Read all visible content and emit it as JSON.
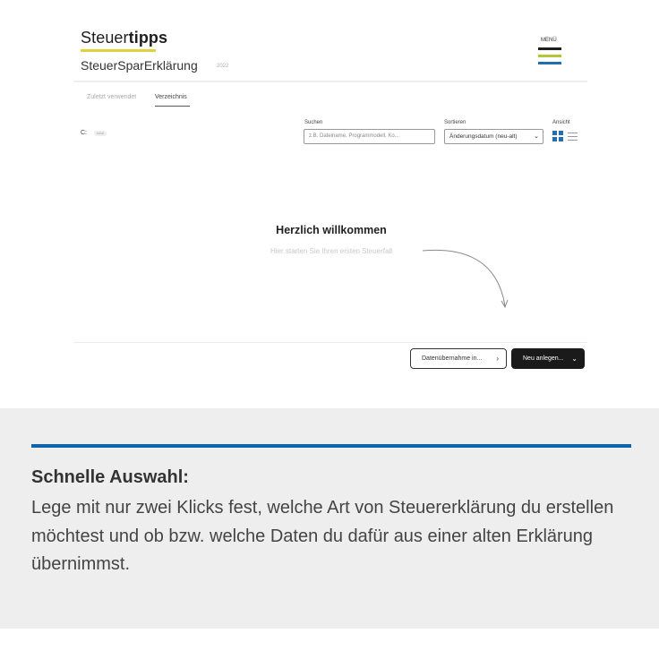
{
  "brand": {
    "name_regular": "Steuer",
    "name_bold": "tipps",
    "product": "SteuerSparErklärung",
    "version": "2022"
  },
  "menu": {
    "label": "MENÜ",
    "colors": [
      "#1e1e1e",
      "#b7c43a",
      "#1f6fb1"
    ]
  },
  "tabs": [
    {
      "label": "Zuletzt verwendet",
      "active": false
    },
    {
      "label": "Verzeichnis",
      "active": true
    }
  ],
  "drive": {
    "label": "C:",
    "badge": "lokal"
  },
  "search": {
    "label": "Suchen",
    "placeholder": "z.B. Dateiname, Programmodell, Ko..."
  },
  "sort": {
    "label": "Sortieren",
    "value": "Änderungsdatum (neu-alt)"
  },
  "view": {
    "label": "Ansicht",
    "active": "grid-icon"
  },
  "welcome": {
    "title": "Herzlich willkommen",
    "subtitle": "Hier starten Sie Ihren ersten Steuerfall"
  },
  "actions": {
    "import_label": "Datenübernahme in...",
    "new_label": "Neu anlegen..."
  },
  "caption": {
    "title": "Schnelle Auswahl:",
    "text": "Lege mit nur zwei Klicks fest, welche Art von Steuererklärung du erstellen möchtest und ob bzw. welche Daten du dafür aus einer alten Erklärung übernimmst.",
    "accent_color": "#0f63a8"
  }
}
